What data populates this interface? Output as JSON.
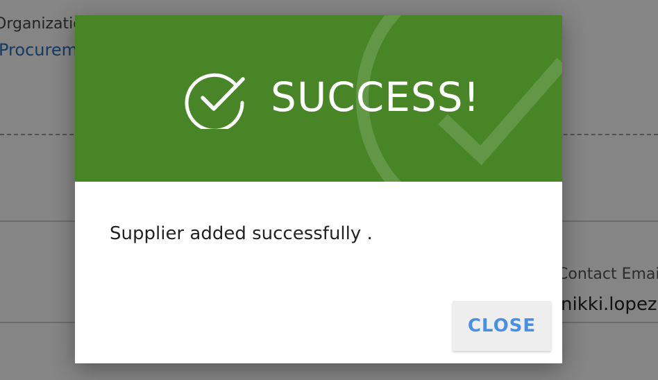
{
  "background_page": {
    "organization_label": "Organization",
    "organization_value": "Procurement",
    "contact_email_label": "Contact Email",
    "contact_email_value": "nikki.lopez@"
  },
  "dialog": {
    "title": "SUCCESS!",
    "icon": "check-circle-icon",
    "message": "Supplier added successfully .",
    "close_label": "CLOSE"
  },
  "colors": {
    "header_green": "#478526",
    "close_text_blue": "#4a90e2",
    "overlay": "rgba(0,0,0,0.48)"
  }
}
